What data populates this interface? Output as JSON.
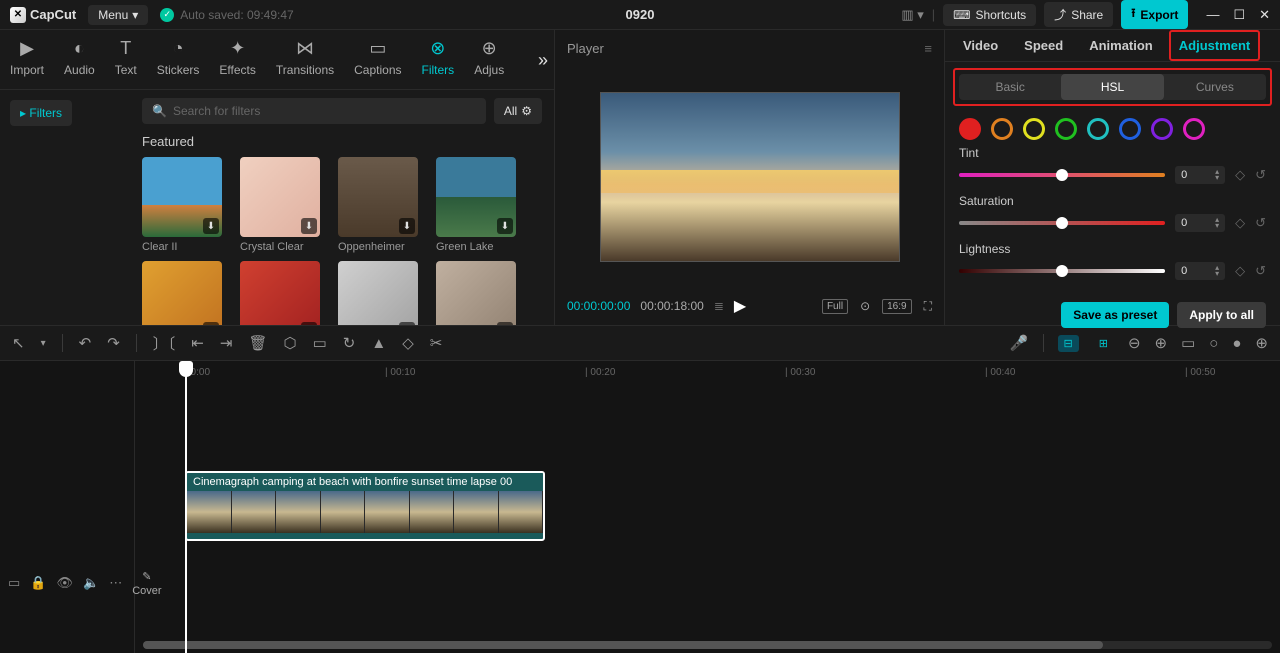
{
  "app": {
    "name": "CapCut",
    "menu": "Menu",
    "autosave": "Auto saved: 09:49:47",
    "title": "0920"
  },
  "topbar": {
    "shortcuts": "Shortcuts",
    "share": "Share",
    "export": "Export"
  },
  "libTabs": [
    {
      "label": "Import",
      "icon": "▶"
    },
    {
      "label": "Audio",
      "icon": "◐"
    },
    {
      "label": "Text",
      "icon": "T"
    },
    {
      "label": "Stickers",
      "icon": "◔"
    },
    {
      "label": "Effects",
      "icon": "✦"
    },
    {
      "label": "Transitions",
      "icon": "⋈"
    },
    {
      "label": "Captions",
      "icon": "▭"
    },
    {
      "label": "Filters",
      "icon": "⊗",
      "active": true
    },
    {
      "label": "Adjus",
      "icon": "⊕"
    }
  ],
  "lib": {
    "filterTag": "Filters",
    "searchPlaceholder": "Search for filters",
    "allLabel": "All",
    "featured": "Featured",
    "thumbs1": [
      {
        "label": "Clear II",
        "bg": "linear-gradient(180deg,#4aa0d0 0%,#4aa0d0 60%,#d08040 60%,#2a6a3a 100%)"
      },
      {
        "label": "Crystal Clear",
        "bg": "linear-gradient(135deg,#f0d0c0,#e0b0a0)"
      },
      {
        "label": "Oppenheimer",
        "bg": "linear-gradient(180deg,#6a5a4a,#4a3a2a)"
      },
      {
        "label": "Green Lake",
        "bg": "linear-gradient(180deg,#3a7a9a 0%,#3a7a9a 50%,#2a5a3a 50%,#4a7a4a 100%)"
      }
    ],
    "thumbs2": [
      {
        "bg": "linear-gradient(135deg,#e0a030,#c07020)"
      },
      {
        "bg": "linear-gradient(135deg,#d04030,#a02020)"
      },
      {
        "bg": "linear-gradient(135deg,#d0d0d0,#a0a0a0)"
      },
      {
        "bg": "linear-gradient(135deg,#c0b0a0,#908070)"
      }
    ]
  },
  "player": {
    "label": "Player",
    "current": "00:00:00:00",
    "total": "00:00:18:00",
    "ratio": "16:9",
    "full": "Full"
  },
  "adjust": {
    "tabs": [
      "Video",
      "Speed",
      "Animation",
      "Adjustment"
    ],
    "activeTab": "Adjustment",
    "subTabs": [
      "Basic",
      "HSL",
      "Curves"
    ],
    "activeSub": "HSL",
    "swatches": [
      {
        "c": "#e02020"
      },
      {
        "c": "#e08020"
      },
      {
        "c": "#e0e020"
      },
      {
        "c": "#20c020"
      },
      {
        "c": "#20c0c0"
      },
      {
        "c": "#2060e0"
      },
      {
        "c": "#8020e0"
      },
      {
        "c": "#e020c0"
      }
    ],
    "sliders": [
      {
        "label": "Tint",
        "grad": "linear-gradient(90deg,#e020c0,#e08020)",
        "pos": 50,
        "val": "0"
      },
      {
        "label": "Saturation",
        "grad": "linear-gradient(90deg,#888,#e02020)",
        "pos": 50,
        "val": "0"
      },
      {
        "label": "Lightness",
        "grad": "linear-gradient(90deg,#300,#fff)",
        "pos": 50,
        "val": "0"
      }
    ],
    "presetBtn": "Save as preset",
    "applyBtn": "Apply to all"
  },
  "timeline": {
    "coverLabel": "Cover",
    "ticks": [
      "00:00",
      "| 00:10",
      "| 00:20",
      "| 00:30",
      "| 00:40",
      "| 00:50"
    ],
    "clipLabel": "Cinemagraph camping at beach with bonfire sunset time lapse  00"
  }
}
